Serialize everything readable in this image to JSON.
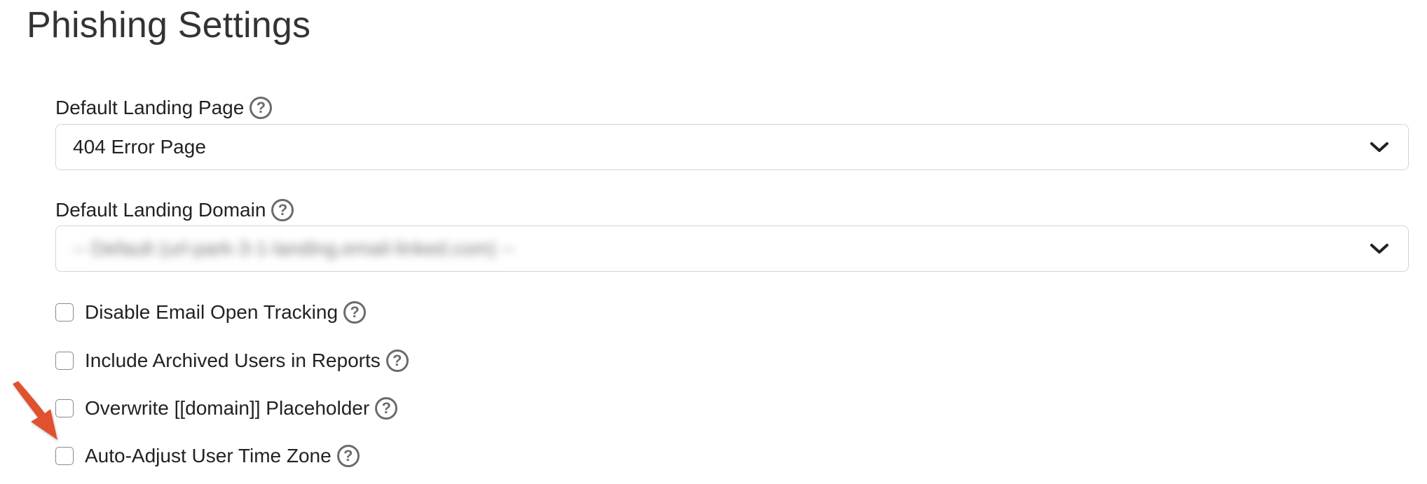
{
  "page": {
    "title": "Phishing Settings"
  },
  "landing_page": {
    "label": "Default Landing Page",
    "value": "404 Error Page"
  },
  "landing_domain": {
    "label": "Default Landing Domain",
    "value": "-- Default (url-park-3-1-landing.email-linked.com) --"
  },
  "checkboxes": [
    {
      "label": "Disable Email Open Tracking",
      "checked": false
    },
    {
      "label": "Include Archived Users in Reports",
      "checked": false
    },
    {
      "label": "Overwrite [[domain]] Placeholder",
      "checked": false
    },
    {
      "label": "Auto-Adjust User Time Zone",
      "checked": false
    }
  ],
  "icons": {
    "help": "?",
    "chevron": "chevron-down-icon",
    "annotation": "arrow-icon"
  },
  "colors": {
    "annotation_arrow": "#e0512f",
    "border": "#d4d4d4",
    "help_icon": "#6b6b6b"
  }
}
